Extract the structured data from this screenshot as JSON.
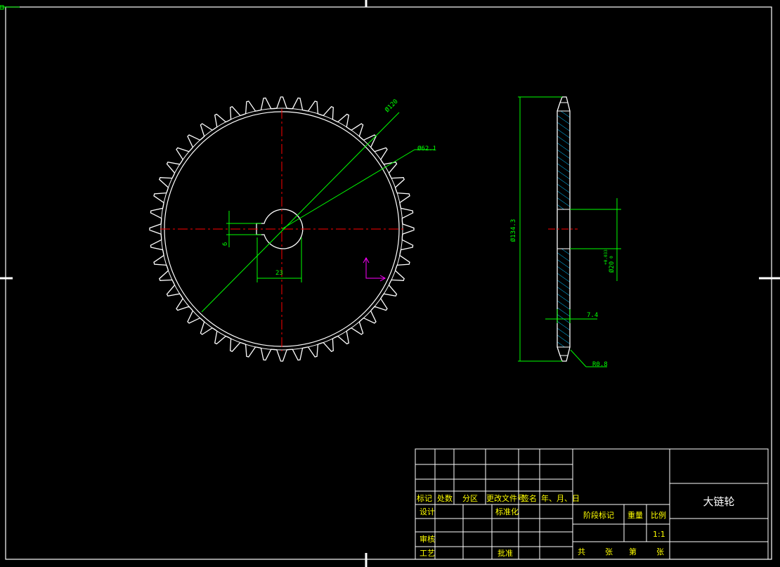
{
  "drawing": {
    "title": "大链轮",
    "scale": "1:1",
    "colors": {
      "background": "#000000",
      "outline": "#ffffff",
      "centerline": "#ff0000",
      "dimension": "#00ff00",
      "title_text": "#ffff00",
      "ucs_icon": "#ff00ff",
      "hatch": "#00bfff"
    }
  },
  "front_view": {
    "tooth_count": 48,
    "dim_outer": "Ø120",
    "dim_inner": "Ø62.1",
    "dim_key_width": "6",
    "dim_key_depth": "23"
  },
  "side_view": {
    "dim_diameter": "Ø134.3",
    "dim_bore": "Ø20",
    "dim_bore_tol_upper": "+0.033",
    "dim_bore_tol_lower": "0",
    "dim_thickness": "7.4",
    "dim_radius": "R0.8"
  },
  "title_block": {
    "rev_headers": [
      "标记",
      "处数",
      "分区",
      "更改文件号",
      "签名",
      "年、月、日"
    ],
    "row_design": "设计",
    "row_standard": "标准化",
    "row_review": "审核",
    "row_process": "工艺",
    "row_approve": "批准",
    "stage_mark": "阶段标记",
    "weight": "重量",
    "ratio": "比例",
    "sheets_total": "共",
    "sheets_unit1": "张",
    "sheets_page": "第",
    "sheets_unit2": "张"
  }
}
